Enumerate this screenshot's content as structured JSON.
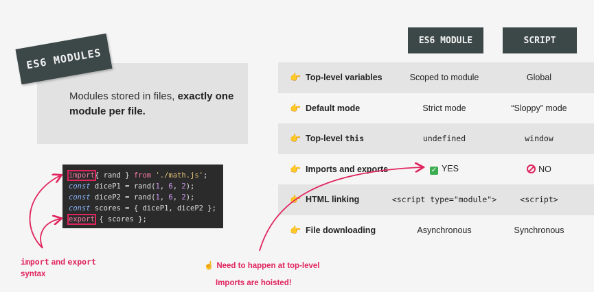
{
  "stamp_title": "ES6 MODULES",
  "info_text_plain": "Modules stored in files, ",
  "info_text_bold": "exactly one module per file.",
  "code": {
    "line1": {
      "import": "import",
      "rest1": "{ rand } ",
      "from": "from",
      "path": "'./math.js'",
      "end": ";"
    },
    "line2": {
      "const": "const",
      "name": " diceP1 = rand(",
      "a": "1",
      "b": "6",
      "c": "2",
      "end": ");"
    },
    "line3": {
      "const": "const",
      "name": " diceP2 = rand(",
      "a": "1",
      "b": "6",
      "c": "2",
      "end": ");"
    },
    "line4": {
      "const": "const",
      "rest": " scores = { diceP1, diceP2 };"
    },
    "line5": {
      "export": "export",
      "rest": " { scores };"
    }
  },
  "headers": {
    "es6": "ES6 MODULE",
    "script": "SCRIPT"
  },
  "rows": [
    {
      "feature": "Top-level variables",
      "module": "Scoped to module",
      "script": "Global"
    },
    {
      "feature": "Default mode",
      "module": "Strict mode",
      "script": "“Sloppy” mode"
    },
    {
      "feature_pre": "Top-level ",
      "feature_mono": "this",
      "module": "undefined",
      "script": "window"
    },
    {
      "feature": "Imports and exports",
      "module": "YES",
      "script": "NO"
    },
    {
      "feature": "HTML linking",
      "module": "<script type=\"module\">",
      "script": "<script>"
    },
    {
      "feature": "File downloading",
      "module": "Asynchronous",
      "script": "Synchronous"
    }
  ],
  "note_left": {
    "mono": "import",
    "and": " and ",
    "mono2": "export",
    "line2": "syntax"
  },
  "note_right": {
    "line1": "Need to happen at top-level",
    "line2": "Imports are hoisted!"
  },
  "icons": {
    "pointer": "pointing-hand-icon",
    "check": "check-box-icon",
    "no": "prohibited-icon",
    "finger_up": "finger-up-icon"
  },
  "colors": {
    "accent": "#e0245e",
    "dark": "#3c4747",
    "shade": "#e4e4e4"
  }
}
